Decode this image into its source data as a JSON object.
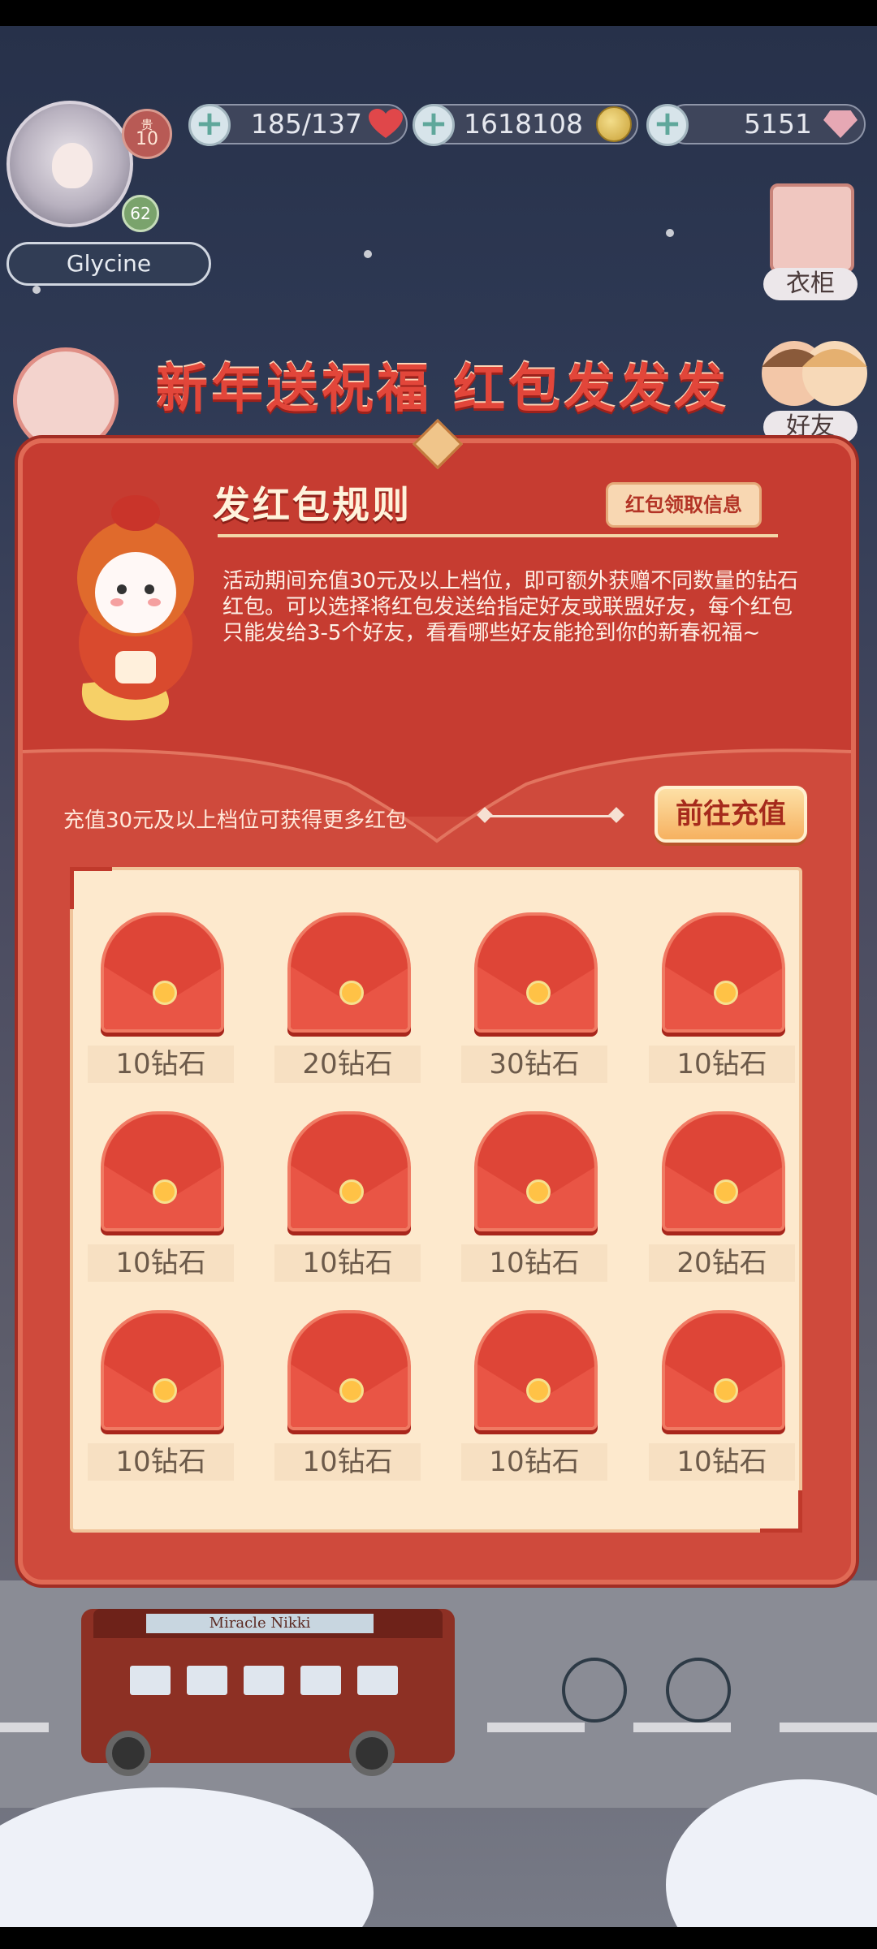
{
  "hud": {
    "player_name": "Glycine",
    "vip_label": "贵",
    "vip_level": "10",
    "player_level": "62",
    "stamina": "185/137",
    "gold": "1618108",
    "diamonds": "5151"
  },
  "side_buttons": {
    "wardrobe": "衣柜",
    "friends": "好友"
  },
  "banner": {
    "title": "新年送祝福  红包发发发"
  },
  "panel": {
    "rules_title": "发红包规则",
    "info_button": "红包领取信息",
    "rules_text": "活动期间充值30元及以上档位，即可额外获赠不同数量的钻石红包。可以选择将红包发送给指定好友或联盟好友，每个红包只能发给3-5个好友，看看哪些好友能抢到你的新春祝福~",
    "recharge_hint": "充值30元及以上档位可获得更多红包",
    "recharge_button": "前往充值"
  },
  "packets": [
    {
      "amount": "10钻石"
    },
    {
      "amount": "20钻石"
    },
    {
      "amount": "30钻石"
    },
    {
      "amount": "10钻石"
    },
    {
      "amount": "10钻石"
    },
    {
      "amount": "10钻石"
    },
    {
      "amount": "10钻石"
    },
    {
      "amount": "20钻石"
    },
    {
      "amount": "10钻石"
    },
    {
      "amount": "10钻石"
    },
    {
      "amount": "10钻石"
    },
    {
      "amount": "10钻石"
    }
  ],
  "bus_sign": "Miracle Nikki",
  "colors": {
    "panel_red": "#cf4a3c",
    "accent_gold": "#f6b160",
    "packet_red": "#de4537"
  }
}
